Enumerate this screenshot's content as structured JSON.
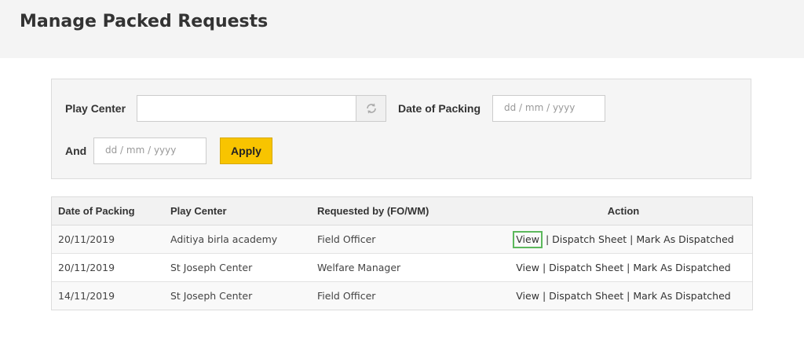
{
  "header": {
    "title": "Manage Packed Requests"
  },
  "filters": {
    "play_center_label": "Play Center",
    "play_center_value": "",
    "date_label": "Date of Packing",
    "date_from_placeholder": "dd / mm / yyyy",
    "and_label": "And",
    "date_to_placeholder": "dd / mm / yyyy",
    "apply_label": "Apply"
  },
  "table": {
    "headers": [
      "Date of Packing",
      "Play Center",
      "Requested by (FO/WM)",
      "Action"
    ],
    "rows": [
      {
        "date": "20/11/2019",
        "center": "Aditiya birla academy",
        "requested_by": "Field Officer",
        "view": "View",
        "dispatch": "Dispatch Sheet",
        "mark": "Mark As Dispatched"
      },
      {
        "date": "20/11/2019",
        "center": "St Joseph Center",
        "requested_by": "Welfare Manager",
        "view": "View",
        "dispatch": "Dispatch Sheet",
        "mark": "Mark As Dispatched"
      },
      {
        "date": "14/11/2019",
        "center": "St Joseph Center",
        "requested_by": "Field Officer",
        "view": "View",
        "dispatch": "Dispatch Sheet",
        "mark": "Mark As Dispatched"
      }
    ],
    "separator": "|"
  }
}
